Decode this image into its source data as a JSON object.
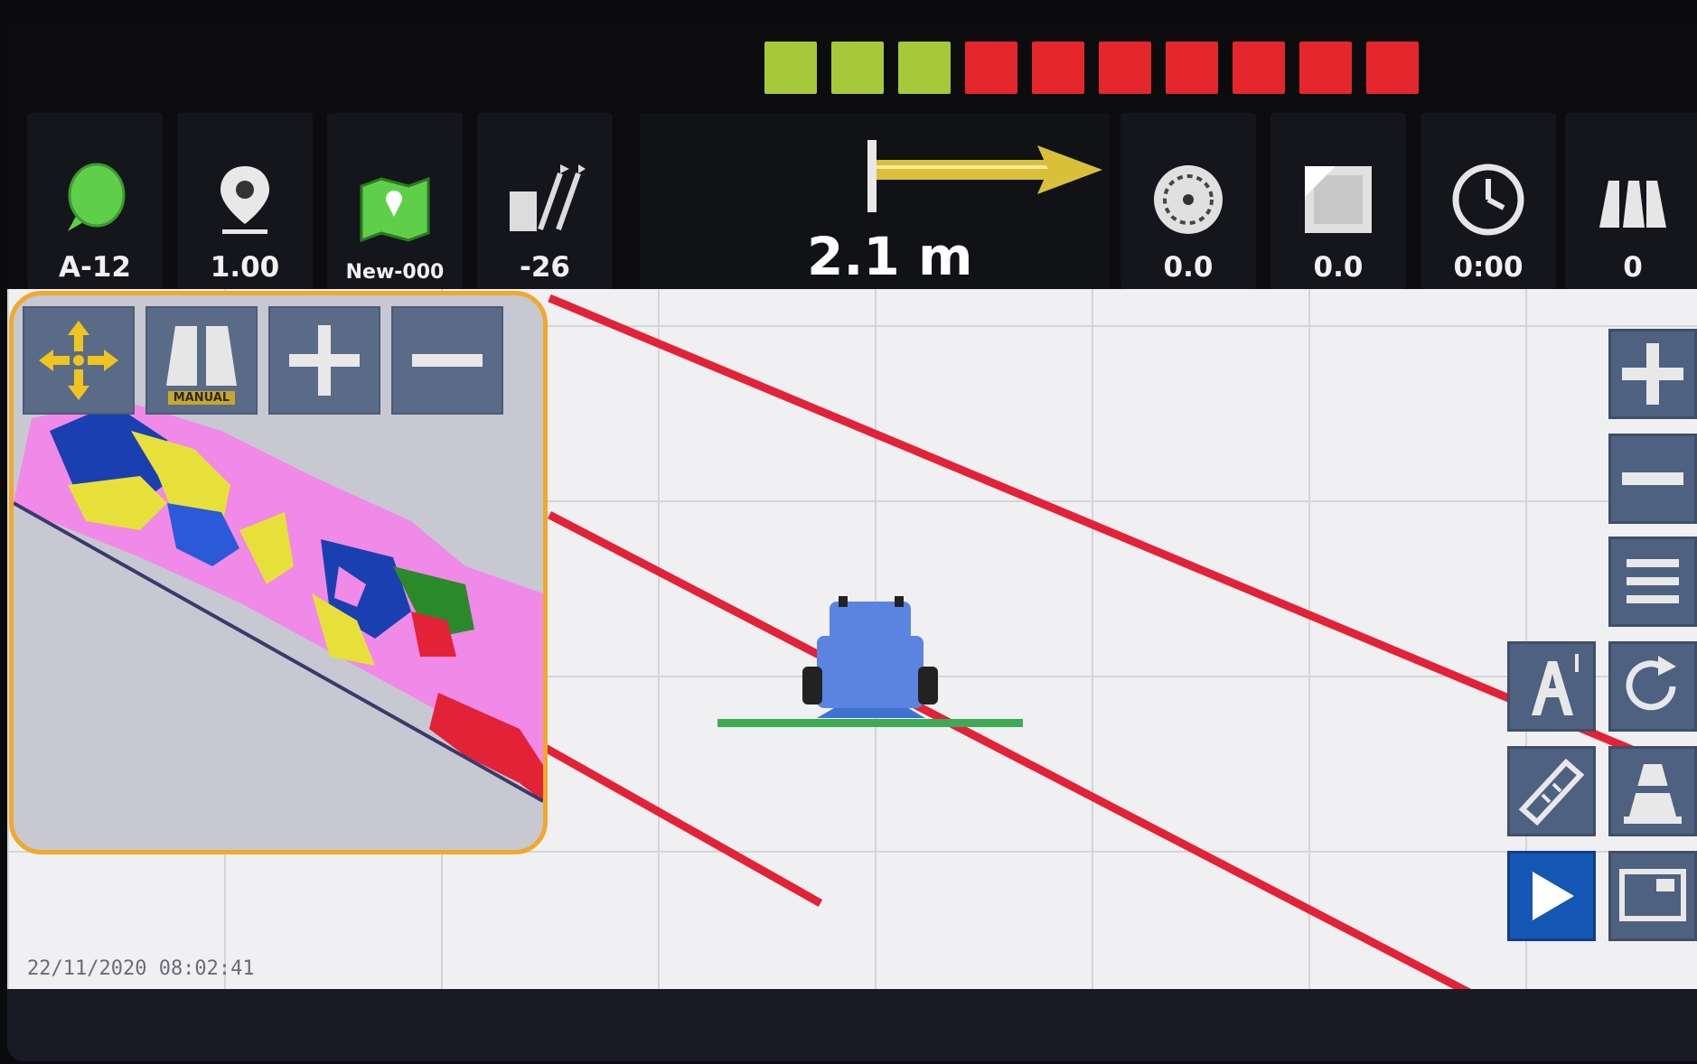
{
  "status_lights": {
    "colors": [
      "#a6c93a",
      "#a6c93a",
      "#a6c93a",
      "#e5262d",
      "#e5262d",
      "#e5262d",
      "#e5262d",
      "#e5262d",
      "#e5262d",
      "#e5262d"
    ]
  },
  "top_tiles": {
    "gnss": {
      "icon": "satellite-signal-icon",
      "value": "A-12"
    },
    "position": {
      "icon": "location-pin-icon",
      "value": "1.00"
    },
    "field": {
      "icon": "field-map-icon",
      "value": "New-000"
    },
    "guidance": {
      "icon": "guidance-line-icon",
      "value": "-26"
    },
    "offset": {
      "icon": "offset-arrow-icon",
      "value": "2.1 m"
    },
    "speed": {
      "icon": "speedometer-icon",
      "value": "0.0"
    },
    "area": {
      "icon": "area-document-icon",
      "value": "0.0"
    },
    "time": {
      "icon": "clock-icon",
      "value": "0:00"
    },
    "sections": {
      "icon": "boom-sections-icon",
      "value": "0"
    }
  },
  "minimap": {
    "buttons": [
      {
        "name": "pan",
        "icon": "pan-arrows-icon"
      },
      {
        "name": "manual",
        "icon": "manual-sections-icon",
        "label": "MANUAL"
      },
      {
        "name": "zoom-in",
        "icon": "plus-icon"
      },
      {
        "name": "zoom-out",
        "icon": "minus-icon"
      }
    ]
  },
  "right_buttons": [
    {
      "name": "zoom-in",
      "icon": "plus-icon"
    },
    {
      "name": "zoom-out",
      "icon": "minus-icon"
    },
    {
      "name": "menu",
      "icon": "menu-icon"
    },
    {
      "name": "ab-line",
      "icon": "ab-line-icon"
    },
    {
      "name": "rotate-view",
      "icon": "rotate-icon"
    },
    {
      "name": "ruler",
      "icon": "ruler-icon"
    },
    {
      "name": "marker",
      "icon": "cone-marker-icon"
    },
    {
      "name": "play",
      "icon": "play-icon"
    },
    {
      "name": "screen",
      "icon": "screen-layout-icon"
    }
  ],
  "timestamp": "22/11/2020 08:02:41",
  "colors": {
    "guidance_line": "#e32237",
    "boom": "#3faa55",
    "vehicle": "#5b84e0",
    "minimap_border": "#f0a92c",
    "button_blue": "#1656b5"
  }
}
